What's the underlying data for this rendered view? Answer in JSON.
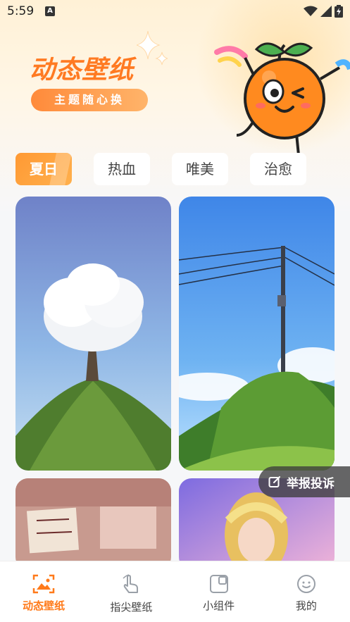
{
  "status_bar": {
    "time": "5:59",
    "notification_badge": "A"
  },
  "header": {
    "title": "动态壁纸",
    "subtitle": "主题随心换",
    "accent_color": "#ff7a22"
  },
  "tabs": [
    {
      "label": "夏日",
      "active": true
    },
    {
      "label": "热血",
      "active": false
    },
    {
      "label": "唯美",
      "active": false
    },
    {
      "label": "治愈",
      "active": false
    }
  ],
  "wallpapers": [
    {
      "name": "cloud-tree-wallpaper"
    },
    {
      "name": "power-pole-wallpaper"
    },
    {
      "name": "handwritten-notes-wallpaper"
    },
    {
      "name": "fantasy-heroine-wallpaper"
    }
  ],
  "report_button": {
    "label": "举报投诉",
    "icon": "edit-icon"
  },
  "bottom_nav": [
    {
      "label": "动态壁纸",
      "icon": "image-frame-icon",
      "active": true
    },
    {
      "label": "指尖壁纸",
      "icon": "finger-tap-icon",
      "active": false
    },
    {
      "label": "小组件",
      "icon": "widget-icon",
      "active": false
    },
    {
      "label": "我的",
      "icon": "smiley-icon",
      "active": false
    }
  ]
}
